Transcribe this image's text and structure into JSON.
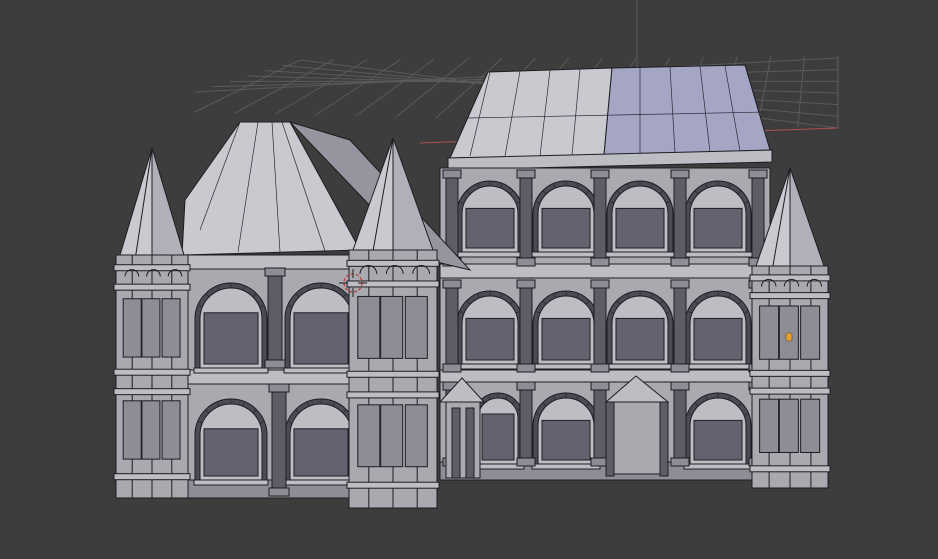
{
  "viewport": {
    "background_color": "#3d3d3d",
    "grid_color": "#5a5a5a",
    "x_axis_color": "#b05050",
    "y_axis_color": "#5a9a5a",
    "z_axis_color": "#6a6ab0"
  },
  "scene": {
    "object": "3d-mansion-model",
    "wall_color": "#a9a9b0",
    "window_color": "#62636f",
    "selected_vertex_color": "#e8a030",
    "cursor_color": "#c83030"
  }
}
